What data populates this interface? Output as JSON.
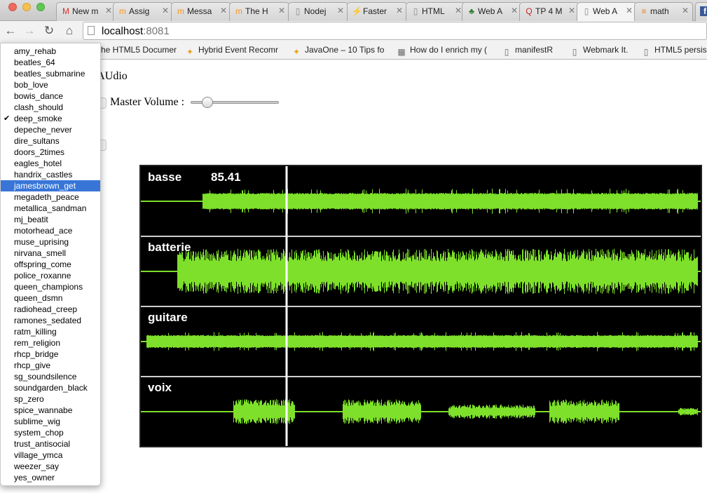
{
  "browser": {
    "tabs": [
      {
        "label": "New m",
        "icon": "gmail-icon",
        "glyph": "M",
        "color": "#d93025"
      },
      {
        "label": "Assig",
        "icon": "moodle-icon",
        "glyph": "m",
        "color": "#f7931e"
      },
      {
        "label": "Messa",
        "icon": "moodle-icon",
        "glyph": "m",
        "color": "#f7931e"
      },
      {
        "label": "The H",
        "icon": "moodle-icon",
        "glyph": "m",
        "color": "#f7931e"
      },
      {
        "label": "Nodej",
        "icon": "page-icon",
        "glyph": "▯",
        "color": "#888888"
      },
      {
        "label": "Faster",
        "icon": "lightning-icon",
        "glyph": "⚡",
        "color": "#2a7de1"
      },
      {
        "label": "HTML",
        "icon": "page-icon",
        "glyph": "▯",
        "color": "#888888"
      },
      {
        "label": "Web A",
        "icon": "tree-icon",
        "glyph": "♣",
        "color": "#2e7d32"
      },
      {
        "label": "TP 4 M",
        "icon": "quiz-icon",
        "glyph": "Q",
        "color": "#c62828"
      },
      {
        "label": "Web A",
        "icon": "page-icon",
        "glyph": "▯",
        "color": "#888888",
        "active": true
      },
      {
        "label": "math",
        "icon": "stack-icon",
        "glyph": "≡",
        "color": "#f48024"
      }
    ],
    "url_host": "localhost",
    "url_port": ":8081",
    "bookmarks": [
      {
        "label": "he HTML5 Documer",
        "icon": "",
        "glyph": ""
      },
      {
        "label": "Hybrid Event Recomr",
        "icon": "hybrid-icon",
        "glyph": "✦"
      },
      {
        "label": "JavaOne – 10 Tips fo",
        "icon": "hybrid-icon",
        "glyph": "✦"
      },
      {
        "label": "How do I enrich my (",
        "icon": "grid-icon",
        "glyph": "▦"
      },
      {
        "label": "manifestR",
        "icon": "page-icon",
        "glyph": "▯"
      },
      {
        "label": "Webmark It.",
        "icon": "page-icon",
        "glyph": "▯"
      },
      {
        "label": "HTML5 persis",
        "icon": "page-icon",
        "glyph": "▯"
      }
    ]
  },
  "page": {
    "title_fragment": "eb AUdio",
    "master_volume_label": "Master Volume :",
    "master_volume": 0.14,
    "current_time": "85.41"
  },
  "tracks": [
    {
      "name": "basse"
    },
    {
      "name": "batterie"
    },
    {
      "name": "guitare"
    },
    {
      "name": "voix"
    }
  ],
  "song_menu": {
    "checked": "deep_smoke",
    "highlighted": "jamesbrown_get",
    "items": [
      "amy_rehab",
      "beatles_64",
      "beatles_submarine",
      "bob_love",
      "bowis_dance",
      "clash_should",
      "deep_smoke",
      "depeche_never",
      "dire_sultans",
      "doors_2times",
      "eagles_hotel",
      "handrix_castles",
      "jamesbrown_get",
      "megadeth_peace",
      "metallica_sandman",
      "mj_beatit",
      "motorhead_ace",
      "muse_uprising",
      "nirvana_smell",
      "offspring_come",
      "police_roxanne",
      "queen_champions",
      "queen_dsmn",
      "radiohead_creep",
      "ramones_sedated",
      "ratm_killing",
      "rem_religion",
      "rhcp_bridge",
      "rhcp_give",
      "sg_soundsilence",
      "soundgarden_black",
      "sp_zero",
      "spice_wannabe",
      "sublime_wig",
      "system_chop",
      "trust_antisocial",
      "village_ymca",
      "weezer_say",
      "yes_owner"
    ]
  },
  "colors": {
    "waveform": "#7ee02a",
    "waveform_core": "#9cff3e",
    "playhead": "#ffffff",
    "selection": "#3875d7"
  }
}
